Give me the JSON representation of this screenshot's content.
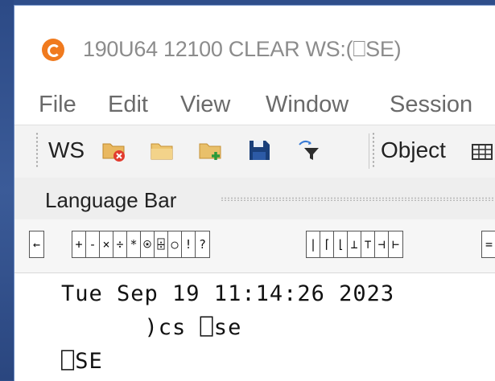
{
  "window": {
    "title": "190U64 12100 CLEAR WS:(⎕SE)"
  },
  "menu": {
    "items": [
      "File",
      "Edit",
      "View",
      "Window",
      "Session"
    ]
  },
  "toolbar": {
    "ws_label": "WS",
    "object_label": "Object",
    "icons": [
      "close-workspace-icon",
      "open-folder-icon",
      "copy-workspace-icon",
      "save-icon",
      "filter-icon",
      "grid-icon"
    ]
  },
  "language_bar": {
    "title": "Language Bar",
    "groups": [
      [
        "←"
      ],
      [
        "+",
        "-",
        "×",
        "÷",
        "*",
        "⍟",
        "⌹",
        "○",
        "!",
        "?"
      ],
      [
        "|",
        "⌈",
        "⌊",
        "⊥",
        "⊤",
        "⊣",
        "⊢"
      ],
      [
        "="
      ]
    ]
  },
  "session": {
    "lines": [
      "Tue Sep 19 11:14:26 2023",
      "      )cs ⎕se",
      "⎕SE"
    ]
  },
  "colors": {
    "app_icon": "#f07a1e",
    "desktop": "#2f4e8a"
  }
}
